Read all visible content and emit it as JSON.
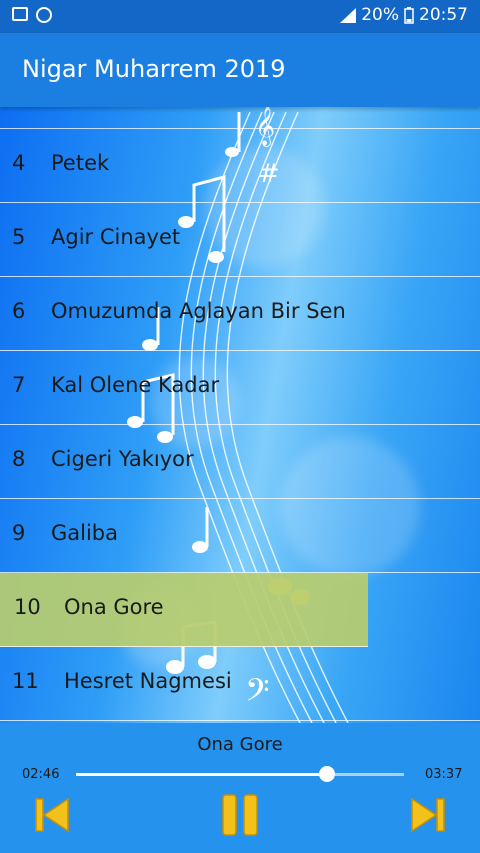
{
  "status": {
    "battery": "20%",
    "time": "20:57",
    "icons": [
      "image-icon",
      "sync-icon",
      "signal-icon",
      "battery-icon"
    ]
  },
  "app": {
    "title": "Nigar Muharrem 2019"
  },
  "songs": [
    {
      "num": "4",
      "name": "Petek"
    },
    {
      "num": "5",
      "name": "Agir Cinayet"
    },
    {
      "num": "6",
      "name": "Omuzumda Aglayan Bir Sen"
    },
    {
      "num": "7",
      "name": "Kal Olene Kadar"
    },
    {
      "num": "8",
      "name": "Cigeri Yakıyor"
    },
    {
      "num": "9",
      "name": "Galiba"
    },
    {
      "num": "10",
      "name": "Ona Gore"
    },
    {
      "num": "11",
      "name": "Hesret Nagmesi"
    }
  ],
  "player": {
    "now_playing": "Ona Gore",
    "elapsed": "02:46",
    "total": "03:37",
    "progress": 0.7649
  },
  "colors": {
    "accent": "#f2c21a",
    "active_row": "#b9cd6e"
  }
}
